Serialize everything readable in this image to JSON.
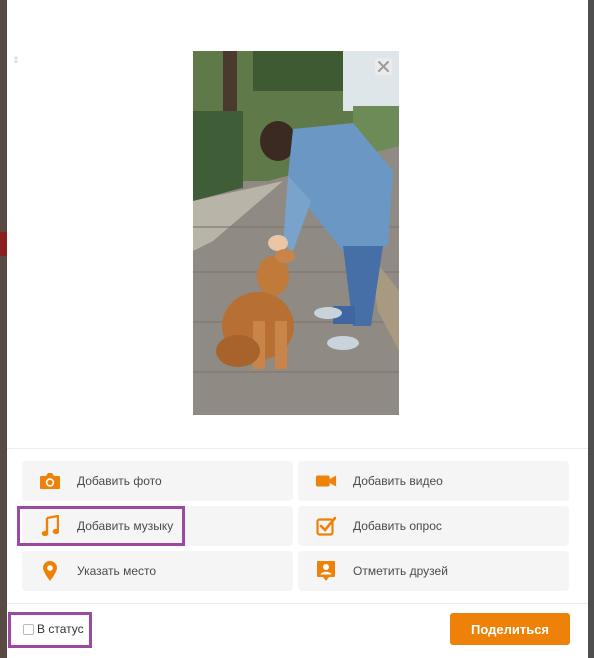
{
  "actions": {
    "add_photo": "Добавить фото",
    "add_video": "Добавить видео",
    "add_music": "Добавить музыку",
    "add_poll": "Добавить опрос",
    "add_place": "Указать место",
    "tag_friends": "Отметить друзей"
  },
  "footer": {
    "status_label": "В статус",
    "share_label": "Поделиться"
  },
  "icons": {
    "close": "close-icon",
    "camera": "camera-icon",
    "video": "video-camera-icon",
    "music": "music-note-icon",
    "poll": "checkbox-icon",
    "place": "location-pin-icon",
    "friends": "person-tag-icon"
  },
  "colors": {
    "accent": "#ee8208",
    "highlight": "#9b4aa1",
    "action_bg": "#f5f5f5"
  }
}
